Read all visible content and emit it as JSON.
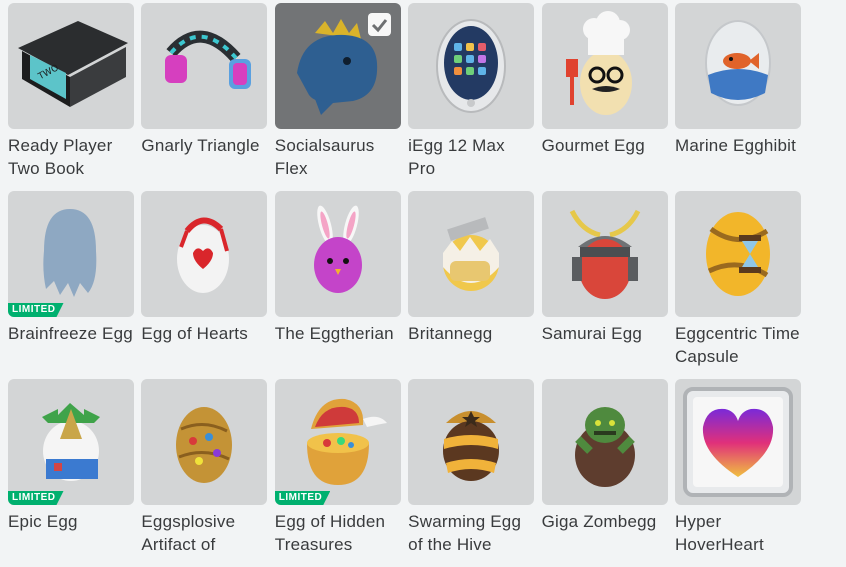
{
  "items": [
    {
      "name": "Ready Player Two Book",
      "limited": false,
      "selected": false,
      "icon": "book-icon"
    },
    {
      "name": "Gnarly Triangle",
      "limited": false,
      "selected": false,
      "icon": "headphones-icon"
    },
    {
      "name": "Socialsaurus Flex",
      "limited": false,
      "selected": true,
      "icon": "dino-hat-icon"
    },
    {
      "name": "iEgg 12 Max Pro",
      "limited": false,
      "selected": false,
      "icon": "phone-egg-icon"
    },
    {
      "name": "Gourmet Egg",
      "limited": false,
      "selected": false,
      "icon": "chef-egg-icon"
    },
    {
      "name": "Marine Egghibit",
      "limited": false,
      "selected": false,
      "icon": "aquarium-egg-icon"
    },
    {
      "name": "Brainfreeze Egg",
      "limited": true,
      "selected": false,
      "icon": "frozen-egg-icon"
    },
    {
      "name": "Egg of Hearts",
      "limited": false,
      "selected": false,
      "icon": "hearts-egg-icon"
    },
    {
      "name": "The Eggtherian",
      "limited": false,
      "selected": false,
      "icon": "bunny-egg-icon"
    },
    {
      "name": "Britannegg",
      "limited": false,
      "selected": false,
      "icon": "cracked-egg-icon"
    },
    {
      "name": "Samurai Egg",
      "limited": false,
      "selected": false,
      "icon": "samurai-egg-icon"
    },
    {
      "name": "Eggcentric Time Capsule",
      "limited": false,
      "selected": false,
      "icon": "hourglass-egg-icon"
    },
    {
      "name": "Epic Egg",
      "limited": true,
      "selected": false,
      "icon": "island-egg-icon"
    },
    {
      "name": "Eggsplosive Artifact of",
      "limited": false,
      "selected": false,
      "icon": "artifact-egg-icon"
    },
    {
      "name": "Egg of Hidden Treasures",
      "limited": true,
      "selected": false,
      "icon": "treasure-egg-icon"
    },
    {
      "name": "Swarming Egg of the Hive",
      "limited": false,
      "selected": false,
      "icon": "hive-egg-icon"
    },
    {
      "name": "Giga Zombegg",
      "limited": false,
      "selected": false,
      "icon": "zombie-egg-icon"
    },
    {
      "name": "Hyper HoverHeart",
      "limited": false,
      "selected": false,
      "icon": "heart-frame-icon"
    }
  ],
  "badge_label": "LIMITED",
  "colors": {
    "tile": "#d3d5d6",
    "tile_selected": "#727476",
    "limited": "#00b06f",
    "text": "#393b3d",
    "background": "#f2f4f5"
  }
}
